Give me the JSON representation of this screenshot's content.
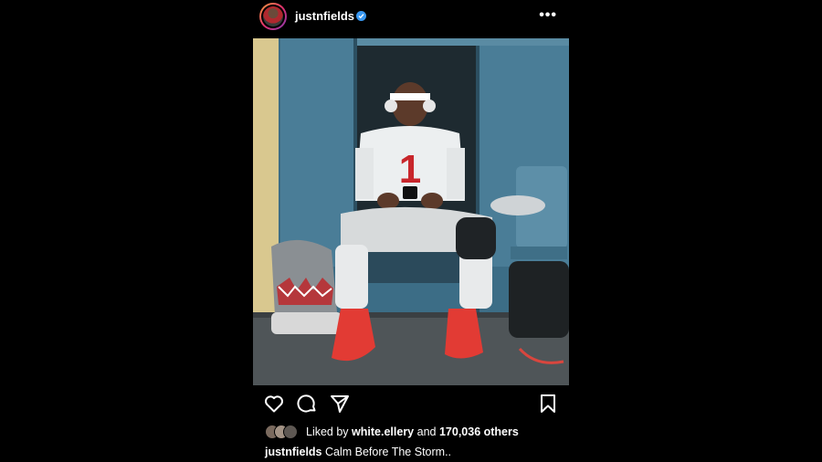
{
  "header": {
    "username": "justnfields",
    "verified_icon": "verified-badge-icon",
    "more_icon": "more-options-icon",
    "more_label": "•••"
  },
  "photo": {
    "description_icon": "locker-room-photo",
    "jersey_number": "1"
  },
  "actions": {
    "like_icon": "heart-icon",
    "comment_icon": "comment-icon",
    "share_icon": "send-icon",
    "save_icon": "bookmark-icon"
  },
  "likes": {
    "prefix": "Liked by",
    "first_user": "white.ellery",
    "joiner": "and",
    "count_text": "170,036 others"
  },
  "caption": {
    "username": "justnfields",
    "text": "Calm Before The Storm.."
  },
  "colors": {
    "background": "#000000",
    "text": "#ffffff",
    "verified": "#3897f0"
  }
}
